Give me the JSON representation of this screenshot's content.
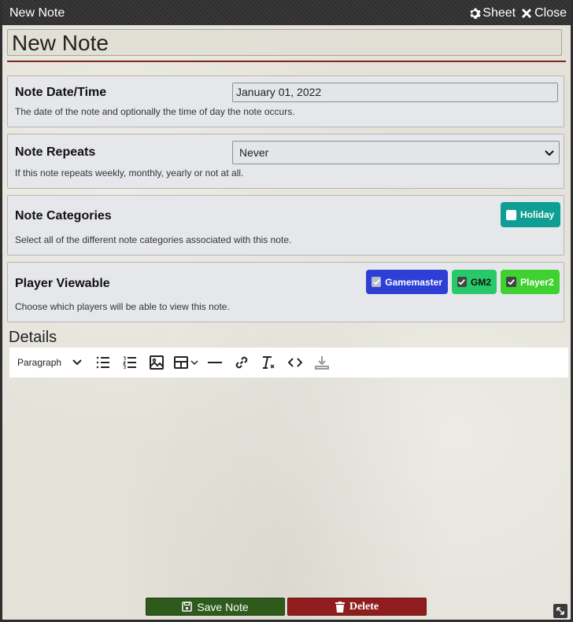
{
  "window": {
    "title": "New Note",
    "sheet_label": "Sheet",
    "close_label": "Close"
  },
  "note": {
    "name": "New Note"
  },
  "date_section": {
    "label": "Note Date/Time",
    "value": "January 01, 2022",
    "hint": "The date of the note and optionally the time of day the note occurs."
  },
  "repeat_section": {
    "label": "Note Repeats",
    "selected": "Never",
    "hint": "If this note repeats weekly, monthly, yearly or not at all."
  },
  "categories_section": {
    "label": "Note Categories",
    "hint": "Select all of the different note categories associated with this note.",
    "tags": [
      {
        "label": "Holiday",
        "checked": false,
        "color": "#0e9e93"
      }
    ]
  },
  "viewable_section": {
    "label": "Player Viewable",
    "hint": "Choose which players will be able to view this note.",
    "players": [
      {
        "label": "Gamemaster",
        "checked": true,
        "disabled": true,
        "color": "#2d3fd4"
      },
      {
        "label": "GM2",
        "checked": true,
        "disabled": false,
        "color": "#27c96b"
      },
      {
        "label": "Player2",
        "checked": true,
        "disabled": false,
        "color": "#3fd12f"
      }
    ]
  },
  "details": {
    "heading": "Details",
    "format_select": "Paragraph",
    "toolbar_icons": [
      "bullet-list-icon",
      "numbered-list-icon",
      "image-icon",
      "table-icon",
      "horizontal-rule-icon",
      "link-icon",
      "clear-format-icon",
      "code-icon",
      "download-icon"
    ]
  },
  "actions": {
    "save_label": "Save Note",
    "delete_label": "Delete",
    "save_color": "#2e5a1c",
    "delete_color": "#8f1d1d"
  }
}
